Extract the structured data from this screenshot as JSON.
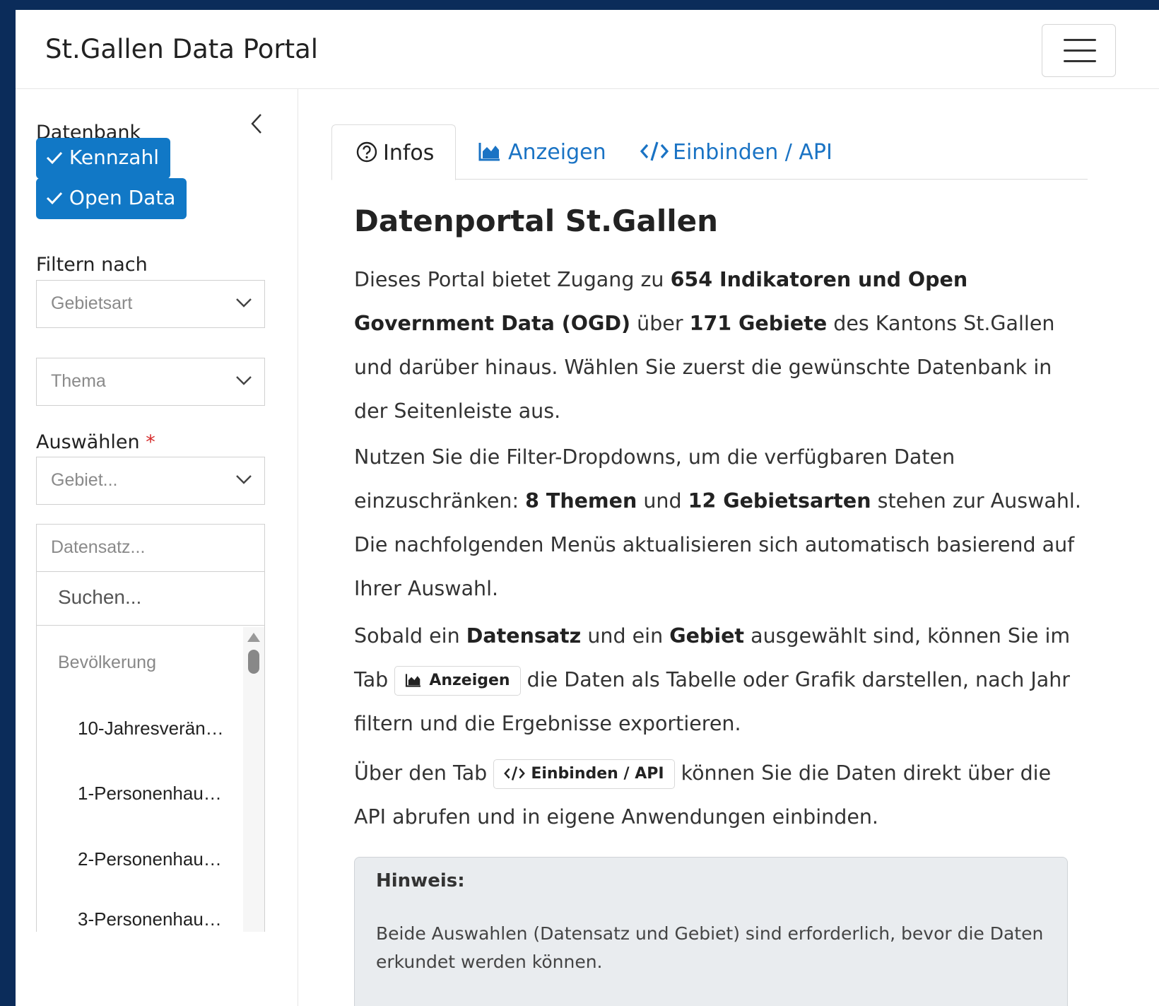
{
  "app": {
    "title": "St.Gallen Data Portal"
  },
  "sidebar": {
    "datenbank_label": "Datenbank",
    "chips": [
      "Kennzahl",
      "Open Data"
    ],
    "filter_label": "Filtern nach",
    "filter_gebietsart_placeholder": "Gebietsart",
    "filter_thema_placeholder": "Thema",
    "auswaehlen_label": "Auswählen",
    "required_mark": "*",
    "gebiet_placeholder": "Gebiet...",
    "datensatz_placeholder": "Datensatz...",
    "search_placeholder": "Suchen...",
    "group_label": "Bevölkerung",
    "options": [
      "10-Jahresverän…",
      "1-Personenhau…",
      "2-Personenhau…",
      "3-Personenhau…"
    ]
  },
  "tabs": {
    "infos": "Infos",
    "anzeigen": "Anzeigen",
    "einbinden": "Einbinden / API"
  },
  "content": {
    "heading": "Datenportal St.Gallen",
    "p1": {
      "a": "Dieses Portal bietet Zugang zu ",
      "b": "654 Indikatoren und Open Government Data (OGD)",
      "c": " über ",
      "d": "171 Gebiete",
      "e": " des Kantons St.Gallen und darüber hinaus. Wählen Sie zuerst die gewünschte Datenbank in der Seitenleiste aus."
    },
    "p2": {
      "a": "Nutzen Sie die Filter-Dropdowns, um die verfügbaren Daten einzuschränken: ",
      "b": "8 Themen",
      "c": " und ",
      "d": "12 Gebietsarten",
      "e": " stehen zur Auswahl. Die nachfolgenden Menüs aktualisieren sich automatisch basierend auf Ihrer Auswahl."
    },
    "p3": {
      "a": "Sobald ein ",
      "b": "Datensatz",
      "c": " und ein ",
      "d": "Gebiet",
      "e": " ausgewählt sind, können Sie im Tab ",
      "code": "Anzeigen",
      "f": " die Daten als Tabelle oder Grafik darstellen, nach Jahr filtern und die Ergebnisse exportieren."
    },
    "p4": {
      "a": "Über den Tab ",
      "code": "Einbinden / API",
      "b": " können Sie die Daten direkt über die API abrufen und in eigene Anwendungen einbinden."
    },
    "hint": {
      "title": "Hinweis:",
      "body": "Beide Auswahlen (Datensatz und Gebiet) sind erforderlich, bevor die Daten erkundet werden können."
    }
  },
  "colors": {
    "accent": "#1178c6",
    "link": "#1a73c4",
    "outer": "#0b2c5a",
    "hint_bg": "#e9ecef"
  }
}
